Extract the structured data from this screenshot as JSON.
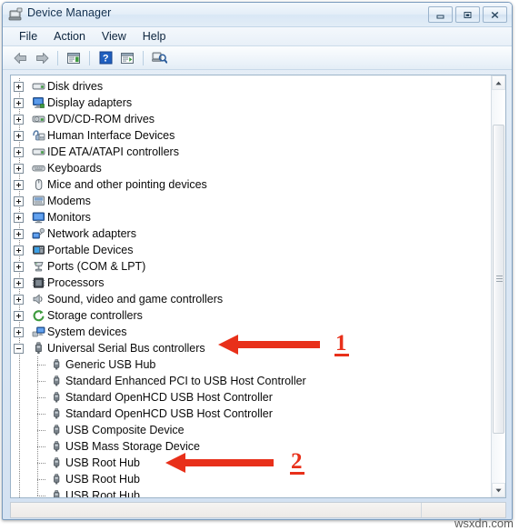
{
  "window": {
    "title": "Device Manager",
    "title_icon": "device-manager-icon",
    "controls": [
      {
        "name": "minimize-button",
        "glyph": "minimize-icon"
      },
      {
        "name": "maximize-button",
        "glyph": "maximize-icon"
      },
      {
        "name": "close-button",
        "glyph": "close-icon"
      }
    ]
  },
  "menubar": {
    "items": [
      {
        "label": "File"
      },
      {
        "label": "Action"
      },
      {
        "label": "View"
      },
      {
        "label": "Help"
      }
    ]
  },
  "toolbar": {
    "buttons": [
      {
        "name": "back-button",
        "icon": "back-arrow-icon"
      },
      {
        "name": "forward-button",
        "icon": "forward-arrow-icon"
      },
      {
        "name": "properties-button",
        "icon": "properties-icon"
      },
      {
        "name": "help-button",
        "icon": "help-question-icon"
      },
      {
        "name": "update-driver-button",
        "icon": "update-driver-icon"
      },
      {
        "name": "scan-hardware-button",
        "icon": "scan-hardware-icon"
      }
    ]
  },
  "tree": {
    "items": [
      {
        "label": "Disk drives",
        "level": 0,
        "state": "collapsed",
        "icon": "disk-drive-icon"
      },
      {
        "label": "Display adapters",
        "level": 0,
        "state": "collapsed",
        "icon": "display-adapter-icon"
      },
      {
        "label": "DVD/CD-ROM drives",
        "level": 0,
        "state": "collapsed",
        "icon": "dvd-drive-icon"
      },
      {
        "label": "Human Interface Devices",
        "level": 0,
        "state": "collapsed",
        "icon": "hid-icon"
      },
      {
        "label": "IDE ATA/ATAPI controllers",
        "level": 0,
        "state": "collapsed",
        "icon": "ide-controller-icon"
      },
      {
        "label": "Keyboards",
        "level": 0,
        "state": "collapsed",
        "icon": "keyboard-icon"
      },
      {
        "label": "Mice and other pointing devices",
        "level": 0,
        "state": "collapsed",
        "icon": "mouse-icon"
      },
      {
        "label": "Modems",
        "level": 0,
        "state": "collapsed",
        "icon": "modem-icon"
      },
      {
        "label": "Monitors",
        "level": 0,
        "state": "collapsed",
        "icon": "monitor-icon"
      },
      {
        "label": "Network adapters",
        "level": 0,
        "state": "collapsed",
        "icon": "network-adapter-icon"
      },
      {
        "label": "Portable Devices",
        "level": 0,
        "state": "collapsed",
        "icon": "portable-device-icon"
      },
      {
        "label": "Ports (COM & LPT)",
        "level": 0,
        "state": "collapsed",
        "icon": "port-icon"
      },
      {
        "label": "Processors",
        "level": 0,
        "state": "collapsed",
        "icon": "processor-icon"
      },
      {
        "label": "Sound, video and game controllers",
        "level": 0,
        "state": "collapsed",
        "icon": "sound-controller-icon"
      },
      {
        "label": "Storage controllers",
        "level": 0,
        "state": "collapsed",
        "icon": "storage-controller-icon"
      },
      {
        "label": "System devices",
        "level": 0,
        "state": "collapsed",
        "icon": "system-device-icon"
      },
      {
        "label": "Universal Serial Bus controllers",
        "level": 0,
        "state": "expanded",
        "icon": "usb-controller-icon"
      },
      {
        "label": "Generic USB Hub",
        "level": 1,
        "state": "leaf",
        "icon": "usb-device-icon"
      },
      {
        "label": "Standard Enhanced PCI to USB Host Controller",
        "level": 1,
        "state": "leaf",
        "icon": "usb-device-icon"
      },
      {
        "label": "Standard OpenHCD USB Host Controller",
        "level": 1,
        "state": "leaf",
        "icon": "usb-device-icon"
      },
      {
        "label": "Standard OpenHCD USB Host Controller",
        "level": 1,
        "state": "leaf",
        "icon": "usb-device-icon"
      },
      {
        "label": "USB Composite Device",
        "level": 1,
        "state": "leaf",
        "icon": "usb-device-icon"
      },
      {
        "label": "USB Mass Storage Device",
        "level": 1,
        "state": "leaf",
        "icon": "usb-device-icon"
      },
      {
        "label": "USB Root Hub",
        "level": 1,
        "state": "leaf",
        "icon": "usb-device-icon"
      },
      {
        "label": "USB Root Hub",
        "level": 1,
        "state": "leaf",
        "icon": "usb-device-icon"
      },
      {
        "label": "USB Root Hub",
        "level": 1,
        "state": "leaf",
        "icon": "usb-device-icon"
      }
    ]
  },
  "scrollbar": {
    "up_arrow": "scroll-up-icon",
    "down_arrow": "scroll-down-icon",
    "thumb": "scroll-thumb"
  },
  "statusbar": {
    "left_text": "",
    "right_text": ""
  },
  "annotations": {
    "color": "#e8301a",
    "markers": [
      {
        "number": "1",
        "target": "Universal Serial Bus controllers"
      },
      {
        "number": "2",
        "target": "USB Root Hub"
      }
    ]
  },
  "watermark": {
    "text": "wsxdn.com"
  }
}
